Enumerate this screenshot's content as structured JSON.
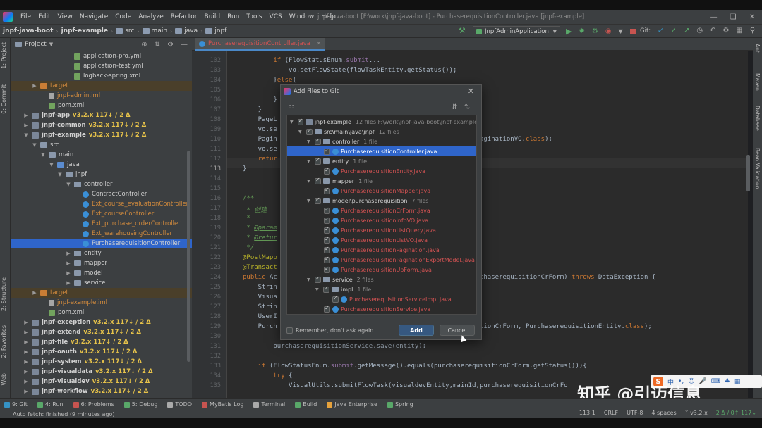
{
  "menu": {
    "items": [
      "File",
      "Edit",
      "View",
      "Navigate",
      "Code",
      "Analyze",
      "Refactor",
      "Build",
      "Run",
      "Tools",
      "VCS",
      "Window",
      "Help"
    ]
  },
  "window_title": "jnpf-java-boot [F:\\work\\jnpf-java-boot] - PurchaserequisitionController.java [jnpf-example]",
  "breadcrumbs": [
    "jnpf-java-boot",
    "jnpf-example",
    "src",
    "main",
    "java",
    "jnpf"
  ],
  "run_config": "JnpfAdminApplication",
  "git_label": "Git:",
  "project": {
    "title": "Project",
    "rows": [
      {
        "label": "application-pro.yml",
        "ind": 78,
        "icon": "xml",
        "cls": "c-white"
      },
      {
        "label": "application-test.yml",
        "ind": 78,
        "icon": "xml",
        "cls": "c-white"
      },
      {
        "label": "logback-spring.xml",
        "ind": 78,
        "icon": "xml",
        "cls": "c-white"
      },
      {
        "label": "target",
        "ind": 30,
        "icon": "folder-orange",
        "cls": "c-orange",
        "arrow": "▶",
        "excl": true
      },
      {
        "label": "jnpf-admin.iml",
        "ind": 42,
        "icon": "file",
        "cls": "c-orange"
      },
      {
        "label": "pom.xml",
        "ind": 42,
        "icon": "xml",
        "cls": "c-white"
      },
      {
        "label": "jnpf-app",
        "tag": "v3.2.x 117↓ / 2 Δ",
        "ind": 18,
        "icon": "mod",
        "cls": "c-white",
        "arrow": "▶",
        "bold": true
      },
      {
        "label": "jnpf-common",
        "tag": "v3.2.x 117↓ / 2 Δ",
        "ind": 18,
        "icon": "mod",
        "cls": "c-white",
        "arrow": "▶",
        "bold": true
      },
      {
        "label": "jnpf-example",
        "tag": "v3.2.x 117↓ / 2 Δ",
        "ind": 18,
        "icon": "mod",
        "cls": "c-white",
        "arrow": "▼",
        "bold": true
      },
      {
        "label": "src",
        "ind": 30,
        "icon": "folder",
        "cls": "c-white",
        "arrow": "▼"
      },
      {
        "label": "main",
        "ind": 42,
        "icon": "folder",
        "cls": "c-white",
        "arrow": "▼"
      },
      {
        "label": "java",
        "ind": 54,
        "icon": "folder-blue",
        "cls": "c-white",
        "arrow": "▼"
      },
      {
        "label": "jnpf",
        "ind": 66,
        "icon": "folder",
        "cls": "c-white",
        "arrow": "▼"
      },
      {
        "label": "controller",
        "ind": 78,
        "icon": "folder",
        "cls": "c-white",
        "arrow": "▼"
      },
      {
        "label": "ContractController",
        "ind": 90,
        "icon": "class",
        "cls": "c-white"
      },
      {
        "label": "Ext_course_evaluationController",
        "ind": 90,
        "icon": "class",
        "cls": "c-orange"
      },
      {
        "label": "Ext_courseController",
        "ind": 90,
        "icon": "class",
        "cls": "c-orange"
      },
      {
        "label": "Ext_purchase_orderController",
        "ind": 90,
        "icon": "class",
        "cls": "c-orange"
      },
      {
        "label": "Ext_warehousingController",
        "ind": 90,
        "icon": "class",
        "cls": "c-orange"
      },
      {
        "label": "PurchaserequisitionController",
        "ind": 90,
        "icon": "class",
        "cls": "c-white",
        "sel": true
      },
      {
        "label": "entity",
        "ind": 78,
        "icon": "folder",
        "cls": "c-white",
        "arrow": "▶"
      },
      {
        "label": "mapper",
        "ind": 78,
        "icon": "folder",
        "cls": "c-white",
        "arrow": "▶"
      },
      {
        "label": "model",
        "ind": 78,
        "icon": "folder",
        "cls": "c-white",
        "arrow": "▶"
      },
      {
        "label": "service",
        "ind": 78,
        "icon": "folder",
        "cls": "c-white",
        "arrow": "▶"
      },
      {
        "label": "target",
        "ind": 30,
        "icon": "folder-orange",
        "cls": "c-orange",
        "arrow": "▶",
        "excl": true
      },
      {
        "label": "jnpf-example.iml",
        "ind": 42,
        "icon": "file",
        "cls": "c-orange"
      },
      {
        "label": "pom.xml",
        "ind": 42,
        "icon": "xml",
        "cls": "c-white"
      },
      {
        "label": "jnpf-exception",
        "tag": "v3.2.x 117↓ / 2 Δ",
        "ind": 18,
        "icon": "mod",
        "cls": "c-white",
        "arrow": "▶",
        "bold": true
      },
      {
        "label": "jnpf-extend",
        "tag": "v3.2.x 117↓ / 2 Δ",
        "ind": 18,
        "icon": "mod",
        "cls": "c-white",
        "arrow": "▶",
        "bold": true
      },
      {
        "label": "jnpf-file",
        "tag": "v3.2.x 117↓ / 2 Δ",
        "ind": 18,
        "icon": "mod",
        "cls": "c-white",
        "arrow": "▶",
        "bold": true
      },
      {
        "label": "jnpf-oauth",
        "tag": "v3.2.x 117↓ / 2 Δ",
        "ind": 18,
        "icon": "mod",
        "cls": "c-white",
        "arrow": "▶",
        "bold": true
      },
      {
        "label": "jnpf-system",
        "tag": "v3.2.x 117↓ / 2 Δ",
        "ind": 18,
        "icon": "mod",
        "cls": "c-white",
        "arrow": "▶",
        "bold": true
      },
      {
        "label": "jnpf-visualdata",
        "tag": "v3.2.x 117↓ / 2 Δ",
        "ind": 18,
        "icon": "mod",
        "cls": "c-white",
        "arrow": "▶",
        "bold": true
      },
      {
        "label": "jnpf-visualdev",
        "tag": "v3.2.x 117↓ / 2 Δ",
        "ind": 18,
        "icon": "mod",
        "cls": "c-white",
        "arrow": "▶",
        "bold": true
      },
      {
        "label": "jnpf-workflow",
        "tag": "v3.2.x 117↓ / 2 Δ",
        "ind": 18,
        "icon": "mod",
        "cls": "c-white",
        "arrow": "▶",
        "bold": true
      }
    ]
  },
  "left_stripe": [
    "1: Project",
    "0: Commit",
    "Z: Structure",
    "2: Favorites",
    "Web"
  ],
  "right_stripe": [
    "Ant",
    "Maven",
    "Database",
    "Bean Validation"
  ],
  "editor": {
    "tab": "PurchaserequisitionController.java",
    "current_line": "113",
    "lines": [
      {
        "n": "102",
        "html": "        <span class='kw'>if</span> (FlowStatusEnum.<span class='purple'>submit</span>..."
      },
      {
        "n": "103",
        "html": "            vo.setFlowState(flowTaskEntity.getStatus());"
      },
      {
        "n": "104",
        "html": "        }<span class='kw'>else</span>{"
      },
      {
        "n": "105",
        "html": "            vo.setFlowState(<span class='kw'>null</span>);"
      },
      {
        "n": "106",
        "html": "        }"
      },
      {
        "n": "107",
        "html": "    }"
      },
      {
        "n": "108",
        "html": "    PageL"
      },
      {
        "n": "109",
        "html": "    vo.se"
      },
      {
        "n": "110",
        "html": "    Pagin                                    itionPagination,PaginationVO.<span class='kw'>class</span>);"
      },
      {
        "n": "111",
        "html": "    vo.se"
      },
      {
        "n": "112",
        "html": "    <span class='kw'>retur</span>"
      },
      {
        "n": "113",
        "html": "}"
      },
      {
        "n": "114",
        "html": ""
      },
      {
        "n": "115",
        "html": ""
      },
      {
        "n": "116",
        "html": "<span class='cm'>/**</span>"
      },
      {
        "n": "117",
        "html": "<span class='cm'> * 创建</span>"
      },
      {
        "n": "118",
        "html": "<span class='cm'> *</span>"
      },
      {
        "n": "119",
        "html": "<span class='cm'> * <u>@param</u></span>"
      },
      {
        "n": "120",
        "html": "<span class='cm'> * <u>@retur</u></span>"
      },
      {
        "n": "121",
        "html": "<span class='cm'> */</span>"
      },
      {
        "n": "122",
        "html": "<span class='ann'>@PostMapp</span>"
      },
      {
        "n": "123",
        "html": "<span class='ann'>@Transact</span>"
      },
      {
        "n": "124",
        "html": "<span class='kw'>public</span> Ac                                    isitionCrForm purchaserequisitionCrForm) <span class='kw'>throws</span> DataException {"
      },
      {
        "n": "125",
        "html": "    Strin"
      },
      {
        "n": "126",
        "html": "    Visua                                    o(visualId);"
      },
      {
        "n": "127",
        "html": "    Strin"
      },
      {
        "n": "128",
        "html": "    UserI"
      },
      {
        "n": "129",
        "html": "    Purch                                    n(purchaserequisitionCrForm, PurchaserequisitionEntity.<span class='kw'>class</span>);"
      },
      {
        "n": "130",
        "html": ""
      },
      {
        "n": "131",
        "html": "        purchaserequisitionService.save(entity);"
      },
      {
        "n": "132",
        "html": ""
      },
      {
        "n": "133",
        "html": "    <span class='kw'>if</span> (FlowStatusEnum.<span class='purple'>submit</span>.getMessage().equals(purchaserequisitionCrForm.getStatus())){"
      },
      {
        "n": "134",
        "html": "        <span class='kw'>try</span> {"
      },
      {
        "n": "135",
        "html": "            VisualUtils.submitFlowTask(visualdevEntity,mainId,purchaserequisitionCrFo"
      }
    ]
  },
  "dialog": {
    "title": "Add Files to Git",
    "rows": [
      {
        "ind": 4,
        "arrow": "▼",
        "label": "jnpf-example",
        "cnt": "12 files  F:\\work\\jnpf-java-boot\\jnpf-example",
        "type": "mod"
      },
      {
        "ind": 16,
        "arrow": "▼",
        "label": "src\\main\\java\\jnpf",
        "cnt": "12 files",
        "type": "folder"
      },
      {
        "ind": 28,
        "arrow": "▼",
        "label": "controller",
        "cnt": "1 file",
        "type": "folder"
      },
      {
        "ind": 52,
        "arrow": "",
        "label": "PurchaserequisitionController.java",
        "cnt": "",
        "type": "file",
        "sel": true
      },
      {
        "ind": 28,
        "arrow": "▼",
        "label": "entity",
        "cnt": "1 file",
        "type": "folder"
      },
      {
        "ind": 52,
        "arrow": "",
        "label": "PurchaserequisitionEntity.java",
        "cnt": "",
        "type": "file"
      },
      {
        "ind": 28,
        "arrow": "▼",
        "label": "mapper",
        "cnt": "1 file",
        "type": "folder"
      },
      {
        "ind": 52,
        "arrow": "",
        "label": "PurchaserequisitionMapper.java",
        "cnt": "",
        "type": "file"
      },
      {
        "ind": 28,
        "arrow": "▼",
        "label": "model\\purchaserequisition",
        "cnt": "7 files",
        "type": "folder"
      },
      {
        "ind": 52,
        "arrow": "",
        "label": "PurchaserequisitionCrForm.java",
        "cnt": "",
        "type": "file"
      },
      {
        "ind": 52,
        "arrow": "",
        "label": "PurchaserequisitionInfoVO.java",
        "cnt": "",
        "type": "file"
      },
      {
        "ind": 52,
        "arrow": "",
        "label": "PurchaserequisitionListQuery.java",
        "cnt": "",
        "type": "file"
      },
      {
        "ind": 52,
        "arrow": "",
        "label": "PurchaserequisitionListVO.java",
        "cnt": "",
        "type": "file"
      },
      {
        "ind": 52,
        "arrow": "",
        "label": "PurchaserequisitionPagination.java",
        "cnt": "",
        "type": "file"
      },
      {
        "ind": 52,
        "arrow": "",
        "label": "PurchaserequisitionPaginationExportModel.java",
        "cnt": "",
        "type": "file"
      },
      {
        "ind": 52,
        "arrow": "",
        "label": "PurchaserequisitionUpForm.java",
        "cnt": "",
        "type": "file"
      },
      {
        "ind": 28,
        "arrow": "▼",
        "label": "service",
        "cnt": "2 files",
        "type": "folder"
      },
      {
        "ind": 40,
        "arrow": "▼",
        "label": "impl",
        "cnt": "1 file",
        "type": "folder"
      },
      {
        "ind": 64,
        "arrow": "",
        "label": "PurchaserequisitionServiceImpl.java",
        "cnt": "",
        "type": "file"
      },
      {
        "ind": 52,
        "arrow": "",
        "label": "PurchaserequisitionService.java",
        "cnt": "",
        "type": "file"
      }
    ],
    "remember": "Remember, don't ask again",
    "add": "Add",
    "cancel": "Cancel"
  },
  "toolwindows": [
    "9: Git",
    "4: Run",
    "6: Problems",
    "5: Debug",
    "TODO",
    "MyBatis Log",
    "Terminal",
    "Build",
    "Java Enterprise",
    "Spring"
  ],
  "status": {
    "message": "Auto fetch: finished (9 minutes ago)",
    "pos": "113:1",
    "crlf": "CRLF",
    "enc": "UTF-8",
    "indent": "4 spaces",
    "branch": "v3.2.x",
    "changes": "2 Δ / 0↑ 117↓"
  },
  "watermark": {
    "text": "知乎 @引迈信息",
    "ime_label": "中"
  },
  "colors": {
    "accent": "#2f65ca",
    "modified_red": "#d25252",
    "ignored_orange": "#d18a3d"
  }
}
